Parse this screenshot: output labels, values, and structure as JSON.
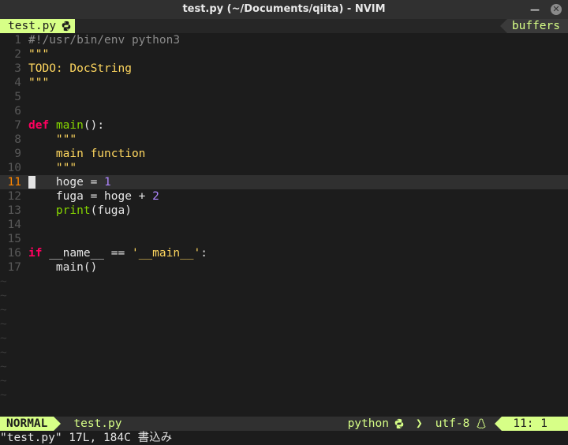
{
  "window": {
    "title": "test.py (~/Documents/qiita) - NVIM"
  },
  "tabline": {
    "active_tab": "test.py",
    "right_label": "buffers"
  },
  "editor": {
    "current_line": 11,
    "lines": [
      {
        "n": "1",
        "text": "#!/usr/bin/env python3"
      },
      {
        "n": "2",
        "text": "\"\"\""
      },
      {
        "n": "3",
        "text": "TODO: DocString"
      },
      {
        "n": "4",
        "text": "\"\"\""
      },
      {
        "n": "5",
        "text": ""
      },
      {
        "n": "6",
        "text": ""
      },
      {
        "n": "7",
        "text": "def main():"
      },
      {
        "n": "8",
        "text": "    \"\"\""
      },
      {
        "n": "9",
        "text": "    main function"
      },
      {
        "n": "10",
        "text": "    \"\"\""
      },
      {
        "n": "11",
        "text": "    hoge = 1"
      },
      {
        "n": "12",
        "text": "    fuga = hoge + 2"
      },
      {
        "n": "13",
        "text": "    print(fuga)"
      },
      {
        "n": "14",
        "text": ""
      },
      {
        "n": "15",
        "text": ""
      },
      {
        "n": "16",
        "text": "if __name__ == '__main__':"
      },
      {
        "n": "17",
        "text": "    main()"
      }
    ],
    "tilde": "~"
  },
  "statusline": {
    "mode": "NORMAL",
    "filename": "test.py",
    "filetype": "python",
    "encoding": "utf-8",
    "position": "11: 1"
  },
  "cmdline": {
    "message": "\"test.py\" 17L, 184C 書込み"
  },
  "colors": {
    "accent": "#d7ff87",
    "keyword": "#ff005f",
    "function": "#87d700",
    "string": "#ffd75f",
    "number": "#af87ff"
  },
  "icons": [
    "python-icon",
    "linux-icon",
    "close-icon",
    "minimize-icon"
  ]
}
